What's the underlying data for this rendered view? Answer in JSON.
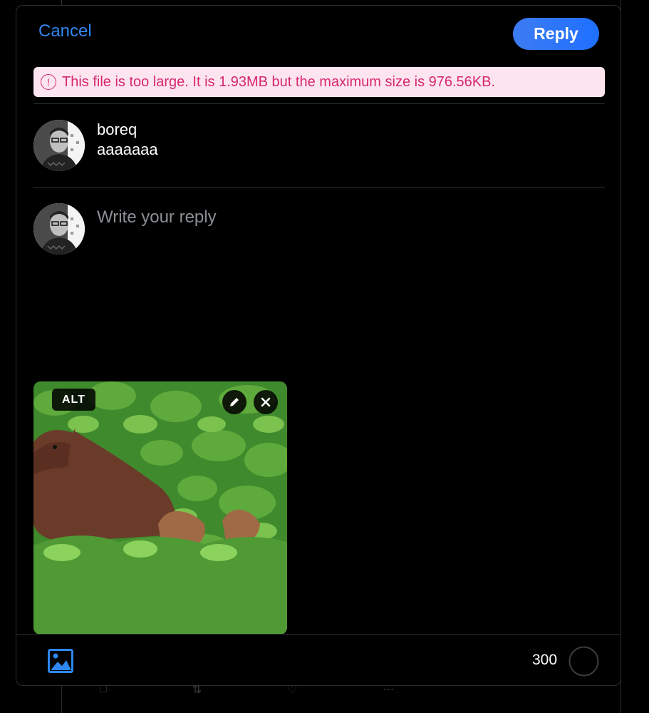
{
  "header": {
    "cancel_label": "Cancel",
    "reply_label": "Reply"
  },
  "error": {
    "icon": "alert-circle-icon",
    "message": "This file is too large. It is 1.93MB but the maximum size is 976.56KB."
  },
  "quoted_post": {
    "author": "boreq",
    "text": "aaaaaaa"
  },
  "composer": {
    "placeholder": "Write your reply",
    "value": ""
  },
  "attachment": {
    "alt_label": "ALT",
    "edit_icon": "pencil-icon",
    "remove_icon": "close-icon"
  },
  "footer": {
    "image_icon": "image-icon",
    "char_count": "300"
  },
  "colors": {
    "accent": "#2f86ef",
    "error_text": "#d62770",
    "error_bg": "#fde5f0"
  }
}
